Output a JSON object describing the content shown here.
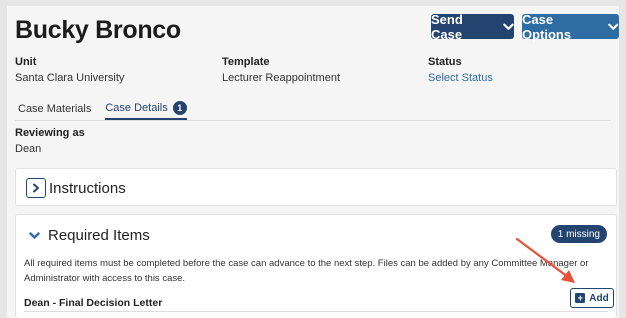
{
  "header": {
    "title": "Bucky Bronco",
    "send_case_label": "Send Case",
    "case_options_label": "Case Options"
  },
  "meta": {
    "unit_label": "Unit",
    "unit_value": "Santa Clara University",
    "template_label": "Template",
    "template_value": "Lecturer Reappointment",
    "status_label": "Status",
    "status_value": "Select Status"
  },
  "tabs": [
    {
      "label": "Case Materials"
    },
    {
      "label": "Case Details",
      "count": "1",
      "active": true
    }
  ],
  "reviewing": {
    "label": "Reviewing as",
    "value": "Dean"
  },
  "instructions": {
    "title": "Instructions"
  },
  "required_items": {
    "title": "Required Items",
    "missing_badge": "1 missing",
    "description": "All required items must be completed before the case can advance to the next step. Files can be added by any Committee Manager or Administrator with access to this case.",
    "items": [
      {
        "label": "Dean - Final Decision Letter",
        "add_label": "Add"
      }
    ]
  },
  "colors": {
    "primary_dark": "#23446f",
    "primary": "#2e6da4",
    "annotation_arrow": "#e8503a"
  },
  "icons": {
    "send_case": "chevron-down-icon",
    "case_options": "chevron-down-icon",
    "instructions_toggle": "chevron-right-icon",
    "required_toggle": "chevron-down-icon",
    "add": "plus-square-icon"
  }
}
